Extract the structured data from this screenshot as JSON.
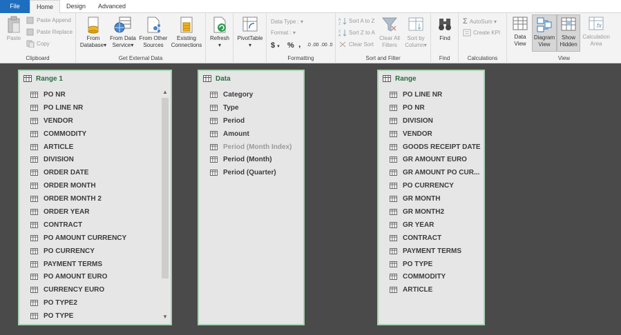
{
  "tabs": [
    "File",
    "Home",
    "Design",
    "Advanced"
  ],
  "clipboard": {
    "paste": "Paste",
    "paste_append": "Paste Append",
    "paste_replace": "Paste Replace",
    "copy": "Copy",
    "label": "Clipboard"
  },
  "external": {
    "from_database_1": "From",
    "from_database_2": "Database",
    "from_data_service_1": "From Data",
    "from_data_service_2": "Service",
    "from_other_1": "From Other",
    "from_other_2": "Sources",
    "existing_1": "Existing",
    "existing_2": "Connections",
    "label": "Get External Data"
  },
  "refresh": {
    "label": "Refresh"
  },
  "pivot": {
    "label": "PivotTable"
  },
  "formatting": {
    "data_type": "Data Type :",
    "format": "Format :",
    "currency": "$",
    "percent": "%",
    "comma": ",",
    "inc_dec": ".0 .00",
    "dec_dec": ".00 .0",
    "label": "Formatting"
  },
  "sort": {
    "az": "Sort A to Z",
    "za": "Sort Z to A",
    "clear_sort": "Clear Sort",
    "clear_all_1": "Clear All",
    "clear_all_2": "Filters",
    "sort_by_1": "Sort by",
    "sort_by_2": "Column",
    "label": "Sort and Filter"
  },
  "find": {
    "btn": "Find",
    "label": "Find"
  },
  "calculations": {
    "autosum": "AutoSum",
    "create_kpi": "Create KPI",
    "label": "Calculations"
  },
  "view": {
    "data_view_1": "Data",
    "data_view_2": "View",
    "diagram_view_1": "Diagram",
    "diagram_view_2": "View",
    "show_hidden_1": "Show",
    "show_hidden_2": "Hidden",
    "calc_area_1": "Calculation",
    "calc_area_2": "Area",
    "label": "View"
  },
  "tables": {
    "range1": {
      "title": "Range 1",
      "columns": [
        "PO NR",
        "PO LINE NR",
        "VENDOR",
        "COMMODITY",
        "ARTICLE",
        "DIVISION",
        "ORDER DATE",
        "ORDER MONTH",
        "ORDER MONTH 2",
        "ORDER YEAR",
        "CONTRACT",
        "PO AMOUNT CURRENCY",
        "PO CURRENCY",
        "PAYMENT TERMS",
        "PO AMOUNT EURO",
        "CURRENCY EURO",
        "PO TYPE2",
        "PO TYPE"
      ]
    },
    "data": {
      "title": "Data",
      "columns": [
        "Category",
        "Type",
        "Period",
        "Amount",
        "Period (Month Index)",
        "Period (Month)",
        "Period (Quarter)"
      ]
    },
    "range": {
      "title": "Range",
      "columns": [
        "PO LINE NR",
        "PO NR",
        "DIVISION",
        "VENDOR",
        "GOODS RECEIPT DATE",
        "GR AMOUNT EURO",
        "GR AMOUNT PO CUR...",
        "PO CURRENCY",
        "GR MONTH",
        "GR MONTH2",
        "GR YEAR",
        "CONTRACT",
        "PAYMENT TERMS",
        "PO TYPE",
        "COMMODITY",
        "ARTICLE"
      ]
    }
  }
}
